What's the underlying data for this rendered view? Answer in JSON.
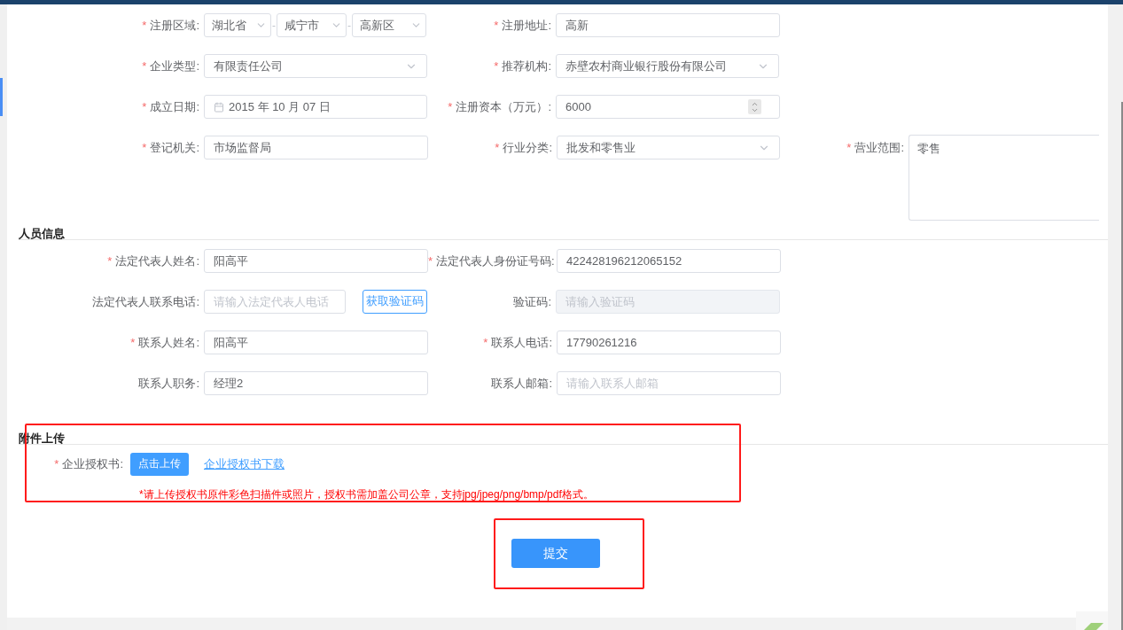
{
  "company_info": {
    "rows": [
      [
        {
          "kind": "region",
          "required_mark": "*",
          "label": "注册区域:",
          "parts": [
            {
              "value": "湖北省"
            },
            {
              "value": "咸宁市"
            },
            {
              "value": "高新区"
            }
          ],
          "separators": [
            "-",
            "-"
          ]
        },
        {
          "kind": "input",
          "required_mark": "*",
          "label": "注册地址:",
          "value": "高新",
          "disabled": false
        }
      ],
      [
        {
          "kind": "select",
          "required_mark": "*",
          "label": "企业类型:",
          "value": "有限责任公司"
        },
        {
          "kind": "select",
          "required_mark": "*",
          "label": "推荐机构:",
          "value": "赤壁农村商业银行股份有限公司"
        }
      ],
      [
        {
          "kind": "date",
          "required_mark": "*",
          "label": "成立日期:",
          "value": "2015 年 10 月 07 日"
        },
        {
          "kind": "number",
          "required_mark": "*",
          "label": "注册资本（万元）:",
          "value": "6000"
        }
      ],
      [
        {
          "kind": "input",
          "required_mark": "*",
          "label": "登记机关:",
          "value": "市场监督局",
          "disabled": false
        },
        {
          "kind": "select",
          "required_mark": "*",
          "label": "行业分类:",
          "value": "批发和零售业"
        },
        {
          "kind": "textarea",
          "required_mark": "*",
          "label": "营业范围:",
          "value": "零售"
        }
      ]
    ]
  },
  "personnel": {
    "title": "人员信息",
    "rows": [
      [
        {
          "kind": "input",
          "required_mark": "*",
          "label": "法定代表人姓名:",
          "value": "阳高平",
          "disabled": false
        },
        {
          "kind": "input",
          "required_mark": "*",
          "label": "法定代表人身份证号码:",
          "value": "422428196212065152",
          "disabled": false
        }
      ],
      [
        {
          "kind": "phone",
          "label": "法定代表人联系电话:",
          "placeholder": "请输入法定代表人电话",
          "action_button": "获取验证码",
          "disabled": false
        },
        {
          "kind": "input",
          "label": "验证码:",
          "placeholder": "请输入验证码",
          "disabled": true
        }
      ],
      [
        {
          "kind": "input",
          "required_mark": "*",
          "label": "联系人姓名:",
          "value": "阳高平",
          "disabled": false
        },
        {
          "kind": "input",
          "required_mark": "*",
          "label": "联系人电话:",
          "value": "17790261216",
          "disabled": false
        }
      ],
      [
        {
          "kind": "input",
          "label": "联系人职务:",
          "value": "经理2",
          "disabled": false
        },
        {
          "kind": "input",
          "label": "联系人邮箱:",
          "placeholder": "请输入联系人邮箱",
          "disabled": false
        }
      ]
    ]
  },
  "attachments": {
    "title": "附件上传",
    "required_mark": "*",
    "label": "企业授权书:",
    "upload_button": "点击上传",
    "download_link": "企业授权书下载",
    "hint": "*请上传授权书原件彩色扫描件或照片，授权书需加盖公司公章，支持jpg/jpeg/png/bmp/pdf格式。"
  },
  "submit_button": "提交"
}
